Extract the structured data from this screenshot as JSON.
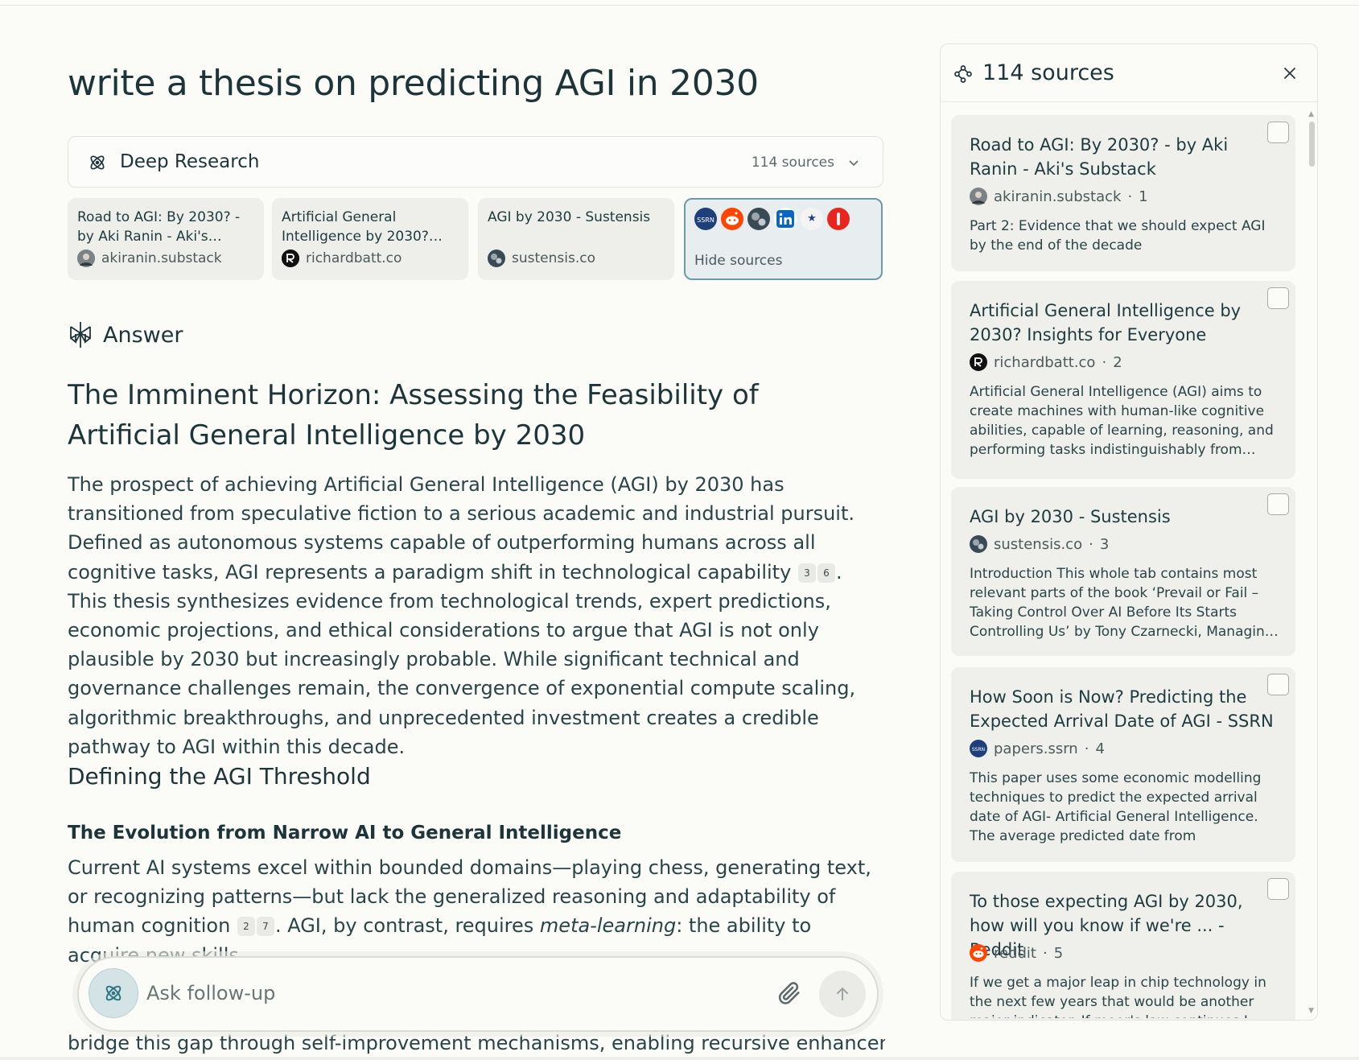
{
  "query": "write a thesis on predicting AGI in 2030",
  "deep_research": {
    "label": "Deep Research",
    "sources_count": "114 sources"
  },
  "source_cards": [
    {
      "title": "Road to AGI: By 2030? - by Aki Ranin - Aki's…",
      "domain": "akiranin.substack"
    },
    {
      "title": "Artificial General Intelligence by 2030?…",
      "domain": "richardbatt.co"
    },
    {
      "title": "AGI by 2030 - Sustensis",
      "domain": "sustensis.co"
    }
  ],
  "hide_sources_label": "Hide sources",
  "answer_label": "Answer",
  "article": {
    "h1": "The Imminent Horizon: Assessing the Feasibility of Artificial General Intelligence by 2030",
    "p1_a": "The prospect of achieving Artificial General Intelligence (AGI) by 2030 has transitioned from speculative fiction to a serious academic and industrial pursuit. Defined as autonomous systems capable of outperforming humans across all cognitive tasks, AGI represents a paradigm shift in technological capability",
    "p1_b": ". This thesis synthesizes evidence from technological trends, expert predictions, economic projections, and ethical considerations to argue that AGI is not only plausible by 2030 but increasingly probable. While significant technical and governance challenges remain, the convergence of exponential compute scaling, algorithmic breakthroughs, and unprecedented investment creates a credible pathway to AGI within this decade.",
    "p1_cites": [
      "3",
      "6"
    ],
    "h2": "Defining the AGI Threshold",
    "h3": "The Evolution from Narrow AI to General Intelligence",
    "p2_a": "Current AI systems excel within bounded domains—playing chess, generating text, or recognizing patterns—but lack the generalized reasoning and adaptability of human cognition",
    "p2_b": ". AGI, by contrast, requires",
    "p2_em": "meta-learning",
    "p2_c": ": the ability to acquire new skills",
    "p2_cites": [
      "2",
      "7"
    ],
    "last_line": "bridge this gap through self-improvement mechanisms, enabling recursive enhancement"
  },
  "followup": {
    "placeholder": "Ask follow-up"
  },
  "panel": {
    "title": "114 sources",
    "sources": [
      {
        "title": "Road to AGI: By 2030? - by Aki Ranin - Aki's Substack",
        "domain": "akiranin.substack",
        "index": "1",
        "desc": "Part 2: Evidence that we should expect AGI by the end of the decade"
      },
      {
        "title": "Artificial General Intelligence by 2030? Insights for Everyone",
        "domain": "richardbatt.co",
        "index": "2",
        "desc": "Artificial General Intelligence (AGI) aims to create machines with human-like cognitive abilities, capable of learning, reasoning, and performing tasks indistinguishably from…"
      },
      {
        "title": "AGI by 2030 - Sustensis",
        "domain": "sustensis.co",
        "index": "3",
        "desc": "Introduction This whole tab contains most relevant parts of the book ‘Prevail or Fail – Taking Control Over AI Before Its Starts Controlling Us’ by Tony Czarnecki, Managin…"
      },
      {
        "title": "How Soon is Now? Predicting the Expected Arrival Date of AGI - SSRN",
        "domain": "papers.ssrn",
        "index": "4",
        "desc": "This paper uses some economic modelling techniques to predict the expected arrival date of AGI- Artificial General Intelligence. The average predicted date from"
      },
      {
        "title": "To those expecting AGI by 2030, how will you know if we're ... - Reddit",
        "domain": "reddit",
        "index": "5",
        "desc": "If we get a major leap in chip technology in the next few years that would be another major indicator. If moor's law continues I…"
      }
    ]
  },
  "colors": {
    "accent": "#6a9ba6",
    "text": "#1d3438",
    "card_bg": "#efefeb",
    "page_bg": "#fbfbf8"
  }
}
